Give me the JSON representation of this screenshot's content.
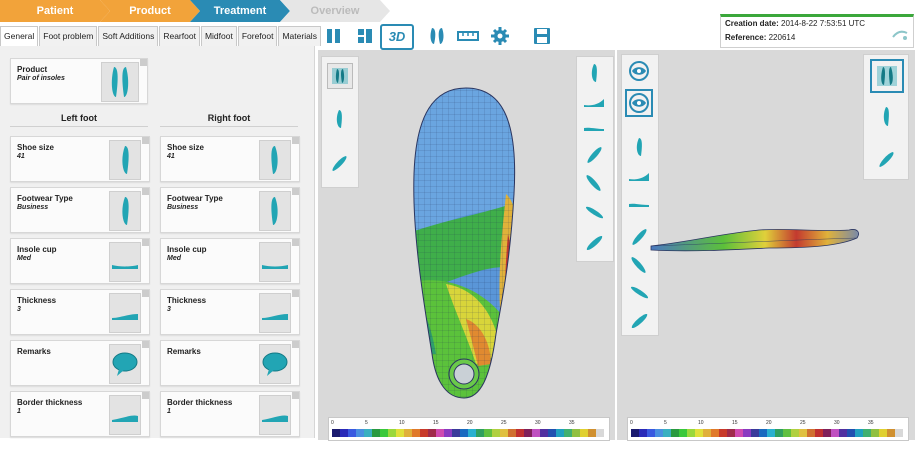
{
  "breadcrumb": [
    "Patient",
    "Product",
    "Treatment",
    "Overview"
  ],
  "info": {
    "creation_label": "Creation date:",
    "creation_value": "2014-8-22 7:53:51 UTC",
    "reference_label": "Reference:",
    "reference_value": "220614"
  },
  "toolbar": {
    "view3d_label": "3D"
  },
  "tabs": [
    "General",
    "Foot problem",
    "Soft Additions",
    "Rearfoot",
    "Midfoot",
    "Forefoot",
    "Materials"
  ],
  "product": {
    "label": "Product",
    "value": "Pair of insoles"
  },
  "left_header": "Left foot",
  "right_header": "Right foot",
  "left_items": [
    {
      "label": "Shoe size",
      "value": "41",
      "icon": "insole-icon"
    },
    {
      "label": "Footwear Type",
      "value": "Business",
      "icon": "shoe-icon"
    },
    {
      "label": "Insole cup",
      "value": "Med",
      "icon": "cup-profile-icon"
    },
    {
      "label": "Thickness",
      "value": "3",
      "icon": "thickness-profile-icon"
    },
    {
      "label": "Remarks",
      "value": "",
      "icon": "speech-bubble-icon"
    },
    {
      "label": "Border thickness",
      "value": "1",
      "icon": "border-profile-icon"
    }
  ],
  "right_items": [
    {
      "label": "Shoe size",
      "value": "41",
      "icon": "insole-icon"
    },
    {
      "label": "Footwear Type",
      "value": "Business",
      "icon": "shoe-icon"
    },
    {
      "label": "Insole cup",
      "value": "Med",
      "icon": "cup-profile-icon"
    },
    {
      "label": "Thickness",
      "value": "3",
      "icon": "thickness-profile-icon"
    },
    {
      "label": "Remarks",
      "value": "",
      "icon": "speech-bubble-icon"
    },
    {
      "label": "Border thickness",
      "value": "1",
      "icon": "border-profile-icon"
    }
  ],
  "legend_ticks": [
    "0",
    "5",
    "10",
    "15",
    "20",
    "25",
    "30",
    "35"
  ],
  "colors": {
    "crumb_done": "#f2a33a",
    "crumb_active": "#2a8bb4",
    "crumb_next": "#e6e6e6",
    "accent": "#2a8bb4",
    "icon_teal": "#22a5b4"
  }
}
